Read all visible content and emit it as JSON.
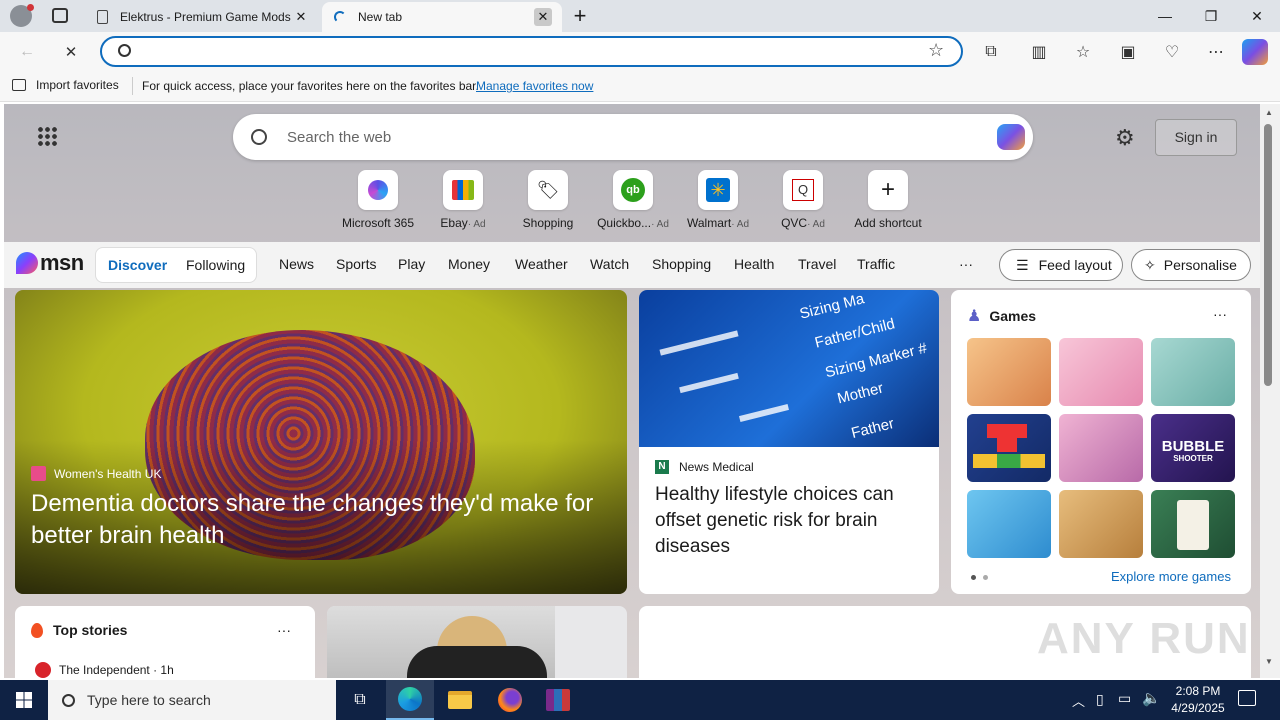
{
  "tabs": [
    {
      "title": "Elektrus - Premium Game Mods |",
      "close": "✕"
    },
    {
      "title": "New tab",
      "close": "✕"
    }
  ],
  "window": {
    "minimize": "—",
    "restore": "❐",
    "close": "✕",
    "new_tab": "+"
  },
  "favorites_bar": {
    "import_label": "Import favorites",
    "message": "For quick access, place your favorites here on the favorites bar.",
    "manage_link": "Manage favorites now"
  },
  "newtab": {
    "search_placeholder": "Search the web",
    "sign_in": "Sign in",
    "shortcuts": [
      {
        "name": "Microsoft 365",
        "ad": ""
      },
      {
        "name": "Ebay",
        "ad": "· Ad"
      },
      {
        "name": "Shopping",
        "ad": ""
      },
      {
        "name": "Quickbo...",
        "ad": "· Ad"
      },
      {
        "name": "Walmart",
        "ad": "· Ad"
      },
      {
        "name": "QVC",
        "ad": "· Ad"
      },
      {
        "name": "Add shortcut",
        "ad": ""
      }
    ]
  },
  "msn": {
    "logo": "msn",
    "toggle": {
      "discover": "Discover",
      "following": "Following"
    },
    "nav": [
      "News",
      "Sports",
      "Play",
      "Money",
      "Weather",
      "Watch",
      "Shopping",
      "Health",
      "Travel",
      "Traffic"
    ],
    "more": "···",
    "feed_layout": "Feed layout",
    "personalise": "Personalise"
  },
  "hero": {
    "source": "Women's Health UK",
    "headline": "Dementia doctors share the changes they'd make for better brain health"
  },
  "dna_card": {
    "image_words": [
      "Sizing Ma",
      "Father/Child",
      "Sizing Marker #",
      "Mother",
      "Father"
    ],
    "source": "News Medical",
    "headline": "Healthy lifestyle choices can offset genetic risk for brain diseases"
  },
  "games": {
    "title": "Games",
    "more": "···",
    "explore": "Explore more games",
    "bubble_line1": "BUBBLE",
    "bubble_line2": "SHOOTER",
    "colors": [
      "#e9a86a",
      "#f1a4c4",
      "#7fbfb7",
      "#1d3b8a",
      "#e6a0c8",
      "#3a2a6e",
      "#4aa5d8",
      "#d9a35b",
      "#2e6e47"
    ]
  },
  "top_stories": {
    "title": "Top stories",
    "more": "···",
    "source": "The Independent · 1h"
  },
  "watermark": "ANY RUN",
  "taskbar": {
    "search_placeholder": "Type here to search",
    "time": "2:08 PM",
    "date": "4/29/2025"
  }
}
